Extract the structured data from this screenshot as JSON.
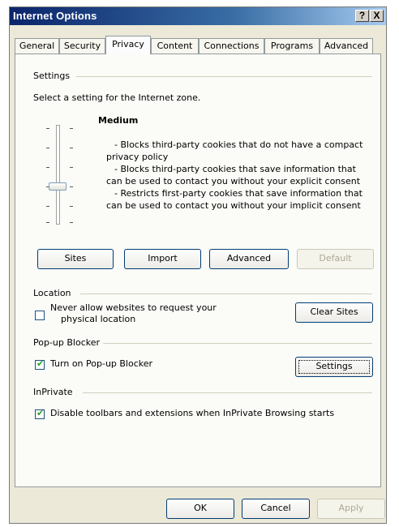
{
  "window": {
    "title": "Internet Options",
    "help_button": "?",
    "close_button": "X"
  },
  "tabs": [
    {
      "label": "General",
      "active": false
    },
    {
      "label": "Security",
      "active": false
    },
    {
      "label": "Privacy",
      "active": true
    },
    {
      "label": "Content",
      "active": false
    },
    {
      "label": "Connections",
      "active": false
    },
    {
      "label": "Programs",
      "active": false
    },
    {
      "label": "Advanced",
      "active": false
    }
  ],
  "settings": {
    "group_label": "Settings",
    "instruction": "Select a setting for the Internet zone.",
    "level": "Medium",
    "slider_position": "Medium",
    "descriptions": [
      "- Blocks third-party cookies that do not have a compact privacy policy",
      "- Blocks third-party cookies that save information that can be used to contact you without your explicit consent",
      "- Restricts first-party cookies that save information that can be used to contact you without your implicit consent"
    ],
    "buttons": {
      "sites": "Sites",
      "import": "Import",
      "advanced": "Advanced",
      "default": "Default"
    }
  },
  "location": {
    "group_label": "Location",
    "checkbox_label_1": "Never allow websites to request your",
    "checkbox_label_2": "physical location",
    "checked": false,
    "clear_sites_button": "Clear Sites"
  },
  "popup_blocker": {
    "group_label": "Pop-up Blocker",
    "checkbox_label": "Turn on Pop-up Blocker",
    "checked": true,
    "settings_button": "Settings"
  },
  "inprivate": {
    "group_label": "InPrivate",
    "checkbox_label": "Disable toolbars and extensions when InPrivate Browsing starts",
    "checked": true
  },
  "footer": {
    "ok": "OK",
    "cancel": "Cancel",
    "apply": "Apply"
  },
  "colors": {
    "title_bar": "#0a246a",
    "check_mark": "#21a121",
    "disabled_text": "#aca899"
  }
}
